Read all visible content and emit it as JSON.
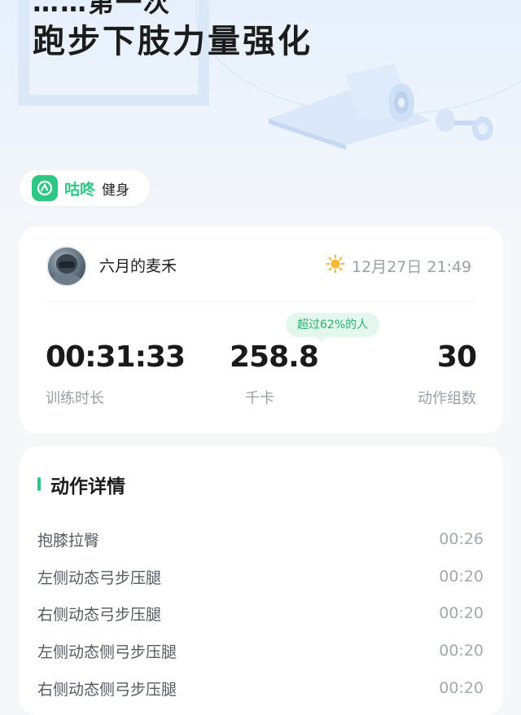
{
  "header": {
    "cut_title": "……第一次",
    "title": "跑步下肢力量强化"
  },
  "brand": {
    "name": "咕咚",
    "sub": "健身",
    "logo_icon": "gudong-logo-icon",
    "accent": "#2ec784"
  },
  "summary": {
    "username": "六月的麦禾",
    "weather_icon": "sun-icon",
    "datetime": "12月27日 21:49",
    "badge": "超过62%的人",
    "stats": [
      {
        "value": "00:31:33",
        "label": "训练时长"
      },
      {
        "value": "258.8",
        "label": "千卡"
      },
      {
        "value": "30",
        "label": "动作组数"
      }
    ]
  },
  "details": {
    "title": "动作详情",
    "items": [
      {
        "name": "抱膝拉臀",
        "time": "00:26"
      },
      {
        "name": "左侧动态弓步压腿",
        "time": "00:20"
      },
      {
        "name": "右侧动态弓步压腿",
        "time": "00:20"
      },
      {
        "name": "左侧动态侧弓步压腿",
        "time": "00:20"
      },
      {
        "name": "右侧动态侧弓步压腿",
        "time": "00:20"
      }
    ]
  }
}
